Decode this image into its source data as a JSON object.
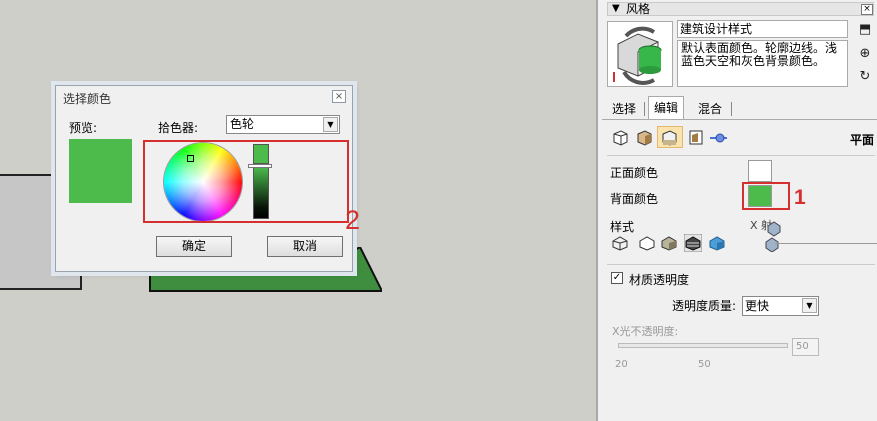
{
  "dialog": {
    "title": "选择颜色",
    "close": "×",
    "preview_label": "预览:",
    "picker_label": "拾色器:",
    "picker_value": "色轮",
    "ok_label": "确定",
    "cancel_label": "取消",
    "color": "#4cbb4c"
  },
  "annotations": {
    "label_1": "1",
    "label_2": "2",
    "color": "#d62f2f"
  },
  "panel": {
    "title": "风格",
    "collapse": "▼",
    "close": "×",
    "style_name": "建筑设计样式",
    "style_description": "默认表面颜色。轮廓边线。浅蓝色天空和灰色背景颜色。",
    "tabs": [
      {
        "label": "选择"
      },
      {
        "label": "编辑"
      },
      {
        "label": "混合"
      }
    ],
    "mode_label": "平面",
    "front_color_label": "正面颜色",
    "back_color_label": "背面颜色",
    "front_color": "#ffffff",
    "back_color": "#4cbb4c",
    "style_label": "样式",
    "xray_label": "X 射",
    "transparency_label": "材质透明度",
    "transparency_checked": "✓",
    "quality_label": "透明度质量:",
    "quality_value": "更快",
    "opacity_label": "X光不透明度:",
    "opacity_value": "50",
    "opacity_ticks": [
      "20",
      "50"
    ]
  }
}
